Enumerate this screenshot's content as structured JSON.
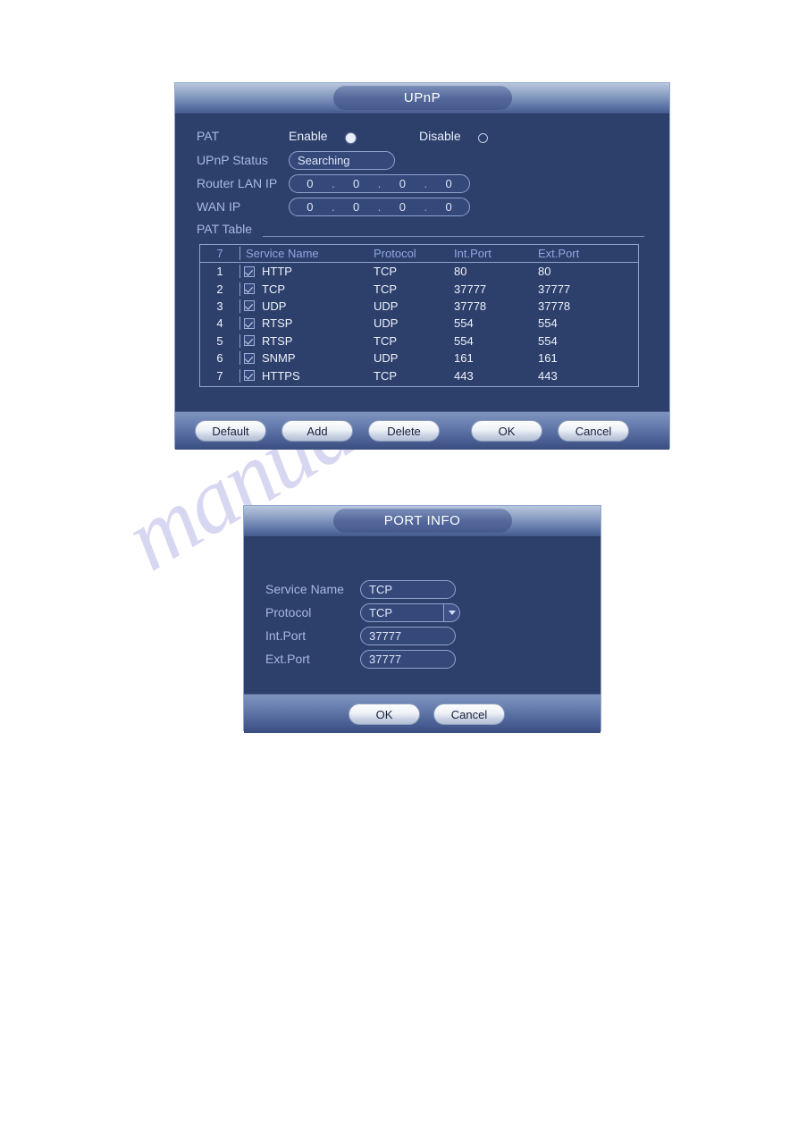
{
  "page": {
    "watermark": "manualslib.com"
  },
  "upnp_dialog": {
    "title": "UPnP",
    "pat": {
      "label": "PAT",
      "enable_label": "Enable",
      "disable_label": "Disable",
      "selected": "Enable"
    },
    "upnp_status": {
      "label": "UPnP Status",
      "value": "Searching"
    },
    "router_lan_ip": {
      "label": "Router LAN IP",
      "octets": [
        "0",
        "0",
        "0",
        "0"
      ],
      "separator": "."
    },
    "wan_ip": {
      "label": "WAN IP",
      "octets": [
        "0",
        "0",
        "0",
        "0"
      ],
      "separator": "."
    },
    "pat_table": {
      "label": "PAT Table",
      "headers": {
        "count": "7",
        "service_name": "Service Name",
        "protocol": "Protocol",
        "int_port": "Int.Port",
        "ext_port": "Ext.Port"
      },
      "rows": [
        {
          "index": "1",
          "checked": true,
          "service_name": "HTTP",
          "protocol": "TCP",
          "int_port": "80",
          "ext_port": "80"
        },
        {
          "index": "2",
          "checked": true,
          "service_name": "TCP",
          "protocol": "TCP",
          "int_port": "37777",
          "ext_port": "37777"
        },
        {
          "index": "3",
          "checked": true,
          "service_name": "UDP",
          "protocol": "UDP",
          "int_port": "37778",
          "ext_port": "37778"
        },
        {
          "index": "4",
          "checked": true,
          "service_name": "RTSP",
          "protocol": "UDP",
          "int_port": "554",
          "ext_port": "554"
        },
        {
          "index": "5",
          "checked": true,
          "service_name": "RTSP",
          "protocol": "TCP",
          "int_port": "554",
          "ext_port": "554"
        },
        {
          "index": "6",
          "checked": true,
          "service_name": "SNMP",
          "protocol": "UDP",
          "int_port": "161",
          "ext_port": "161"
        },
        {
          "index": "7",
          "checked": true,
          "service_name": "HTTPS",
          "protocol": "TCP",
          "int_port": "443",
          "ext_port": "443"
        }
      ]
    },
    "buttons": {
      "default": "Default",
      "add": "Add",
      "delete": "Delete",
      "ok": "OK",
      "cancel": "Cancel"
    }
  },
  "port_info_dialog": {
    "title": "PORT INFO",
    "fields": {
      "service_name_label": "Service Name",
      "service_name_value": "TCP",
      "protocol_label": "Protocol",
      "protocol_value": "TCP",
      "int_port_label": "Int.Port",
      "int_port_value": "37777",
      "ext_port_label": "Ext.Port",
      "ext_port_value": "37777"
    },
    "buttons": {
      "ok": "OK",
      "cancel": "Cancel"
    }
  },
  "colors": {
    "dialog_bg": "#2d3f6b",
    "label_text": "#a8b8e4",
    "value_text": "#eef2fb",
    "header_text": "#8fa6e2",
    "border": "#8fa2cc",
    "watermark": "#b9b8e8"
  }
}
